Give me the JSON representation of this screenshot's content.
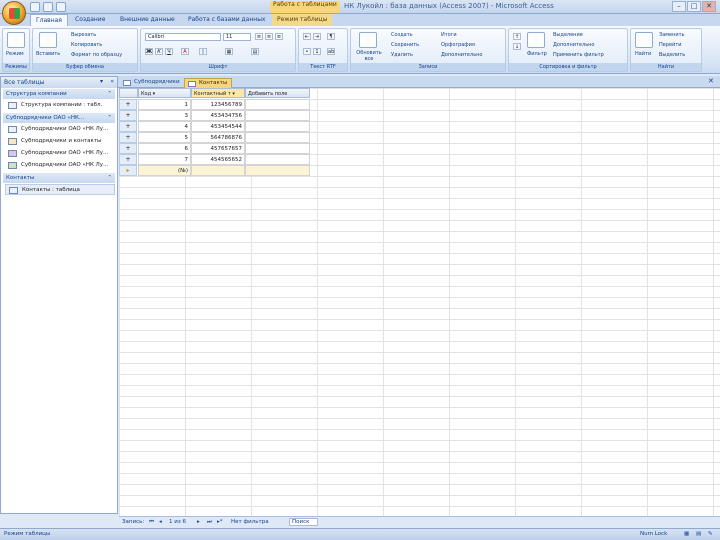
{
  "window": {
    "title": "НК Лукойл : база данных (Access 2007) - Microsoft Access",
    "context_label": "Работа с таблицами",
    "buttons": {
      "minimize": "–",
      "maximize": "□",
      "close": "✕"
    }
  },
  "ribbon_tabs": [
    "Главная",
    "Создание",
    "Внешние данные",
    "Работа с базами данных",
    "Режим таблицы"
  ],
  "ribbon": {
    "groups": [
      "Режимы",
      "Буфер обмена",
      "Шрифт",
      "Текст RTF",
      "Записи",
      "Сортировка и фильтр",
      "Найти"
    ],
    "view": {
      "label": "Режим"
    },
    "clipboard": {
      "paste": "Вставить",
      "cut": "Вырезать",
      "copy": "Копировать",
      "format": "Формат по образцу"
    },
    "font": {
      "name": "Calibri",
      "size": "11"
    },
    "records": {
      "refresh": "Обновить все",
      "new": "Создать",
      "save": "Сохранить",
      "delete": "Удалить",
      "totals": "Итоги",
      "spelling": "Орфография",
      "more": "Дополнительно"
    },
    "sort": {
      "filter": "Фильтр",
      "selection": "Выделение",
      "advanced": "Дополнительно",
      "toggle": "Применить фильтр"
    },
    "find": {
      "find": "Найти",
      "replace": "Заменить",
      "goto": "Перейти",
      "select": "Выделить"
    }
  },
  "nav_pane": {
    "header": "Все таблицы",
    "sections": [
      {
        "title": "Структура компании",
        "items": [
          "Структура компании : табл."
        ]
      },
      {
        "title": "Субподрядчики ОАО «НК…",
        "items": [
          "Субподрядчики ОАО «НК Лу…",
          "Субподрядчики и контакты",
          "Субподрядчики ОАО «НК Лу…",
          "Субподрядчики ОАО «НК Лу…"
        ]
      },
      {
        "title": "Контакты",
        "items": [
          "Контакты : таблица"
        ]
      }
    ]
  },
  "doc_tabs": [
    "Субподрядчики",
    "Контакты"
  ],
  "datasheet": {
    "columns": [
      "Код",
      "Контактный т",
      "Добавить поле"
    ],
    "rows": [
      {
        "code": "1",
        "phone": "123456789"
      },
      {
        "code": "3",
        "phone": "453434756"
      },
      {
        "code": "4",
        "phone": "453454544"
      },
      {
        "code": "5",
        "phone": "564786876"
      },
      {
        "code": "6",
        "phone": "457657657"
      },
      {
        "code": "7",
        "phone": "454565652"
      }
    ],
    "new_row": {
      "code": "(№)",
      "phone": ""
    }
  },
  "record_nav": {
    "label": "Запись:",
    "position": "1 из 6",
    "no_filter": "Нет фильтра",
    "search": "Поиск"
  },
  "status": {
    "left": "Режим таблицы",
    "right": "Num Lock"
  }
}
